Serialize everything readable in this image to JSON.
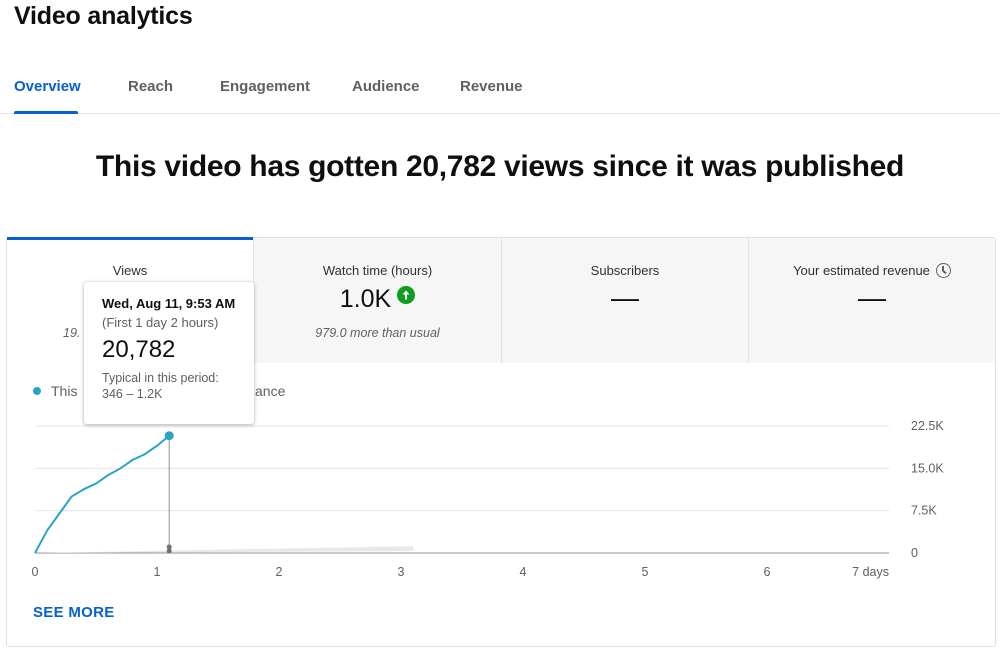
{
  "page": {
    "title": "Video analytics"
  },
  "tabs": [
    {
      "label": "Overview",
      "active": true
    },
    {
      "label": "Reach",
      "active": false
    },
    {
      "label": "Engagement",
      "active": false
    },
    {
      "label": "Audience",
      "active": false
    },
    {
      "label": "Revenue",
      "active": false
    }
  ],
  "headline": "This video has gotten 20,782 views since it was published",
  "metrics": [
    {
      "label": "Views",
      "sub_partial": "19.",
      "active": true
    },
    {
      "label": "Watch time (hours)",
      "value": "1.0K",
      "sub": "979.0 more than usual",
      "trend_icon": "arrow-up-icon",
      "trend_color": "#0f9d1f"
    },
    {
      "label": "Subscribers",
      "value": "—"
    },
    {
      "label": "Your estimated revenue",
      "value": "—",
      "info_icon": "clock-icon"
    }
  ],
  "legend": {
    "series_partial": "This",
    "typical_partial": "ance",
    "color": "#2ba3c6"
  },
  "tooltip": {
    "date": "Wed, Aug 11, 9:53 AM",
    "period": "(First 1 day 2 hours)",
    "value": "20,782",
    "typical_label": "Typical in this period:",
    "typical_range": "346 – 1.2K"
  },
  "chart_data": {
    "type": "line",
    "x_tick_labels": [
      "0",
      "1",
      "2",
      "3",
      "4",
      "5",
      "6",
      "7 days"
    ],
    "y_tick_labels": [
      "22.5K",
      "15.0K",
      "7.5K",
      "0"
    ],
    "ylim": [
      0,
      22500
    ],
    "xlim": [
      0,
      7
    ],
    "series": [
      {
        "color": "#2ba3c6",
        "x": [
          0,
          0.05,
          0.1,
          0.2,
          0.3,
          0.4,
          0.5,
          0.6,
          0.7,
          0.8,
          0.9,
          1.0,
          1.1
        ],
        "values": [
          0,
          2000,
          4000,
          7000,
          10000,
          11300,
          12300,
          13800,
          15000,
          16500,
          17500,
          19000,
          20782
        ]
      }
    ],
    "typical_band": {
      "color": "#e8e8e8",
      "x": [
        0,
        3.1
      ],
      "low": [
        0,
        346
      ],
      "high": [
        0,
        1200
      ]
    },
    "hover_x": 1.1,
    "colors": {
      "line": "#2ba3c6",
      "grid": "#e5e5e5",
      "axis": "#909090"
    }
  },
  "see_more": "SEE MORE"
}
